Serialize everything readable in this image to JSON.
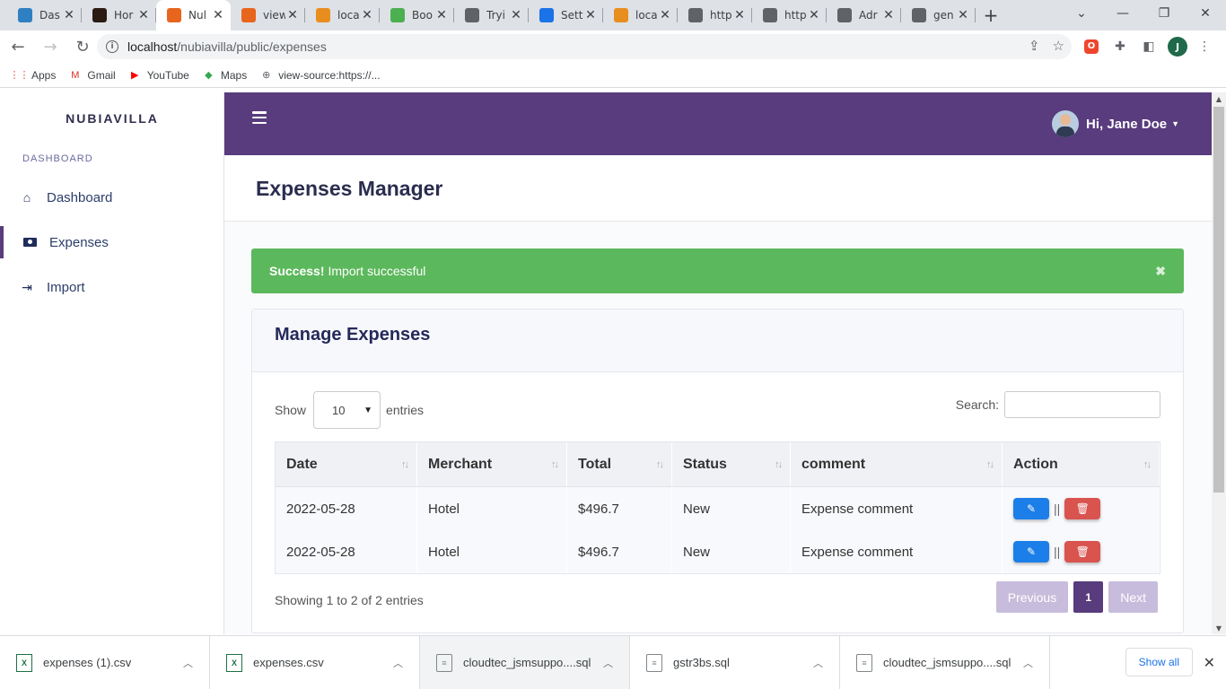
{
  "browser": {
    "tabs": [
      {
        "title": "Das",
        "icon": "dashboard-icon",
        "color": "#2f80c3"
      },
      {
        "title": "Hor",
        "icon": "app-icon",
        "color": "#2b1b12"
      },
      {
        "title": "Nul",
        "icon": "xampp-icon",
        "color": "#e8651e",
        "active": true
      },
      {
        "title": "view",
        "icon": "xampp-icon",
        "color": "#e8651e"
      },
      {
        "title": "loca",
        "icon": "phpmyadmin-icon",
        "color": "#e88e1e"
      },
      {
        "title": "Boo",
        "icon": "w3schools-icon",
        "color": "#4caf50"
      },
      {
        "title": "Tryi",
        "icon": "globe-icon",
        "color": "#5f6368"
      },
      {
        "title": "Sett",
        "icon": "gear-icon",
        "color": "#1a73e8"
      },
      {
        "title": "loca",
        "icon": "phpmyadmin-icon",
        "color": "#e88e1e"
      },
      {
        "title": "http",
        "icon": "globe-icon",
        "color": "#5f6368"
      },
      {
        "title": "http",
        "icon": "globe-icon",
        "color": "#5f6368"
      },
      {
        "title": "Adr",
        "icon": "globe-icon",
        "color": "#5f6368"
      },
      {
        "title": "gen",
        "icon": "globe-icon",
        "color": "#5f6368"
      }
    ],
    "url_host": "localhost",
    "url_path": "/nubiavilla/public/expenses",
    "profile_initial": "J",
    "bookmarks": [
      {
        "label": "Apps",
        "icon": "apps-grid-icon"
      },
      {
        "label": "Gmail",
        "icon": "gmail-icon"
      },
      {
        "label": "YouTube",
        "icon": "youtube-icon"
      },
      {
        "label": "Maps",
        "icon": "maps-icon"
      },
      {
        "label": "view-source:https://...",
        "icon": "globe-icon"
      }
    ]
  },
  "sidebar": {
    "brand": "NUBIAVILLA",
    "section": "DASHBOARD",
    "items": [
      {
        "label": "Dashboard",
        "icon": "home-icon"
      },
      {
        "label": "Expenses",
        "icon": "money-icon",
        "active": true
      },
      {
        "label": "Import",
        "icon": "import-icon"
      }
    ]
  },
  "topbar": {
    "greeting": "Hi, Jane Doe"
  },
  "header": {
    "title": "Expenses Manager"
  },
  "alert": {
    "strong": "Success!",
    "message": "Import successful",
    "close": "✖"
  },
  "card": {
    "title": "Manage Expenses",
    "show_label": "Show",
    "page_length": "10",
    "entries_label": "entries",
    "search_label": "Search:",
    "columns": [
      "Date",
      "Merchant",
      "Total",
      "Status",
      "comment",
      "Action"
    ],
    "rows": [
      {
        "date": "2022-05-28",
        "merchant": "Hotel",
        "total": "$496.7",
        "status": "New",
        "comment": "Expense comment"
      },
      {
        "date": "2022-05-28",
        "merchant": "Hotel",
        "total": "$496.7",
        "status": "New",
        "comment": "Expense comment"
      }
    ],
    "action_separator": "||",
    "info": "Showing 1 to 2 of 2 entries",
    "pager": {
      "previous": "Previous",
      "current": "1",
      "next": "Next"
    }
  },
  "downloads": {
    "items": [
      {
        "name": "expenses (1).csv",
        "type": "xl"
      },
      {
        "name": "expenses.csv",
        "type": "xl"
      },
      {
        "name": "cloudtec_jsmsuppo....sql",
        "type": "sql",
        "highlight": true
      },
      {
        "name": "gstr3bs.sql",
        "type": "sql"
      },
      {
        "name": "cloudtec_jsmsuppo....sql",
        "type": "sql"
      }
    ],
    "show_all": "Show all"
  },
  "colors": {
    "primary": "#583c7d",
    "success": "#5cb85c",
    "edit": "#1c7ee8",
    "delete": "#d9534f"
  }
}
